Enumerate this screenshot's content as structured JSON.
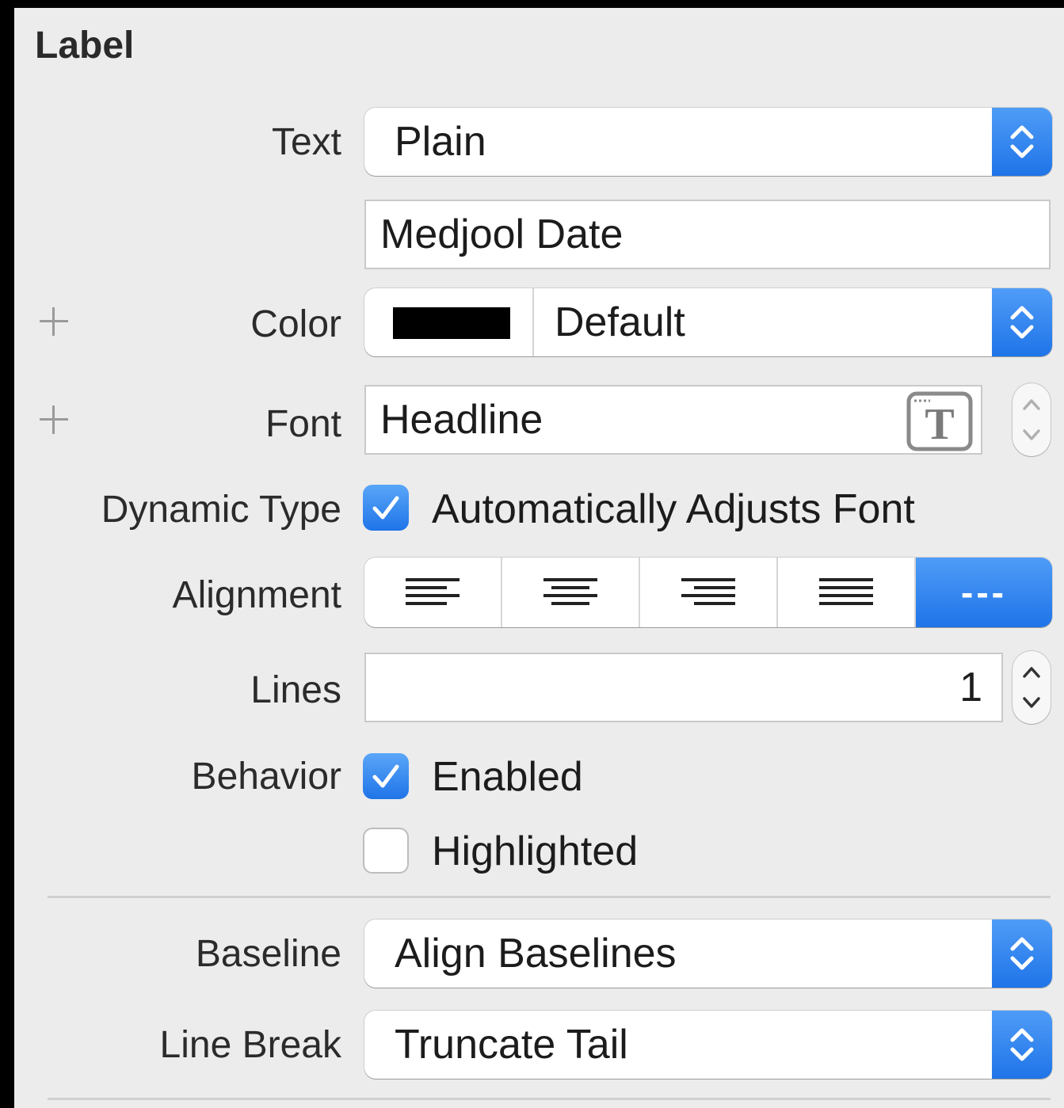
{
  "section": {
    "title": "Label"
  },
  "text_row": {
    "label": "Text",
    "value": "Plain"
  },
  "text_field": {
    "value": "Medjool Date"
  },
  "color_row": {
    "label": "Color",
    "value": "Default",
    "swatch_color": "#000000"
  },
  "font_row": {
    "label": "Font",
    "value": "Headline"
  },
  "dynamic_type_row": {
    "label": "Dynamic Type",
    "checkbox_label": "Automatically Adjusts Font",
    "checked": true
  },
  "alignment_row": {
    "label": "Alignment",
    "options": [
      "left",
      "center",
      "right",
      "justified",
      "natural"
    ],
    "selected": "natural",
    "natural_glyph": "---"
  },
  "lines_row": {
    "label": "Lines",
    "value": "1"
  },
  "behavior_row": {
    "label": "Behavior",
    "enabled_label": "Enabled",
    "enabled_checked": true,
    "highlighted_label": "Highlighted",
    "highlighted_checked": false
  },
  "baseline_row": {
    "label": "Baseline",
    "value": "Align Baselines"
  },
  "line_break_row": {
    "label": "Line Break",
    "value": "Truncate Tail"
  },
  "colors": {
    "accent": "#1f74e8",
    "panel_bg": "#ececec"
  }
}
